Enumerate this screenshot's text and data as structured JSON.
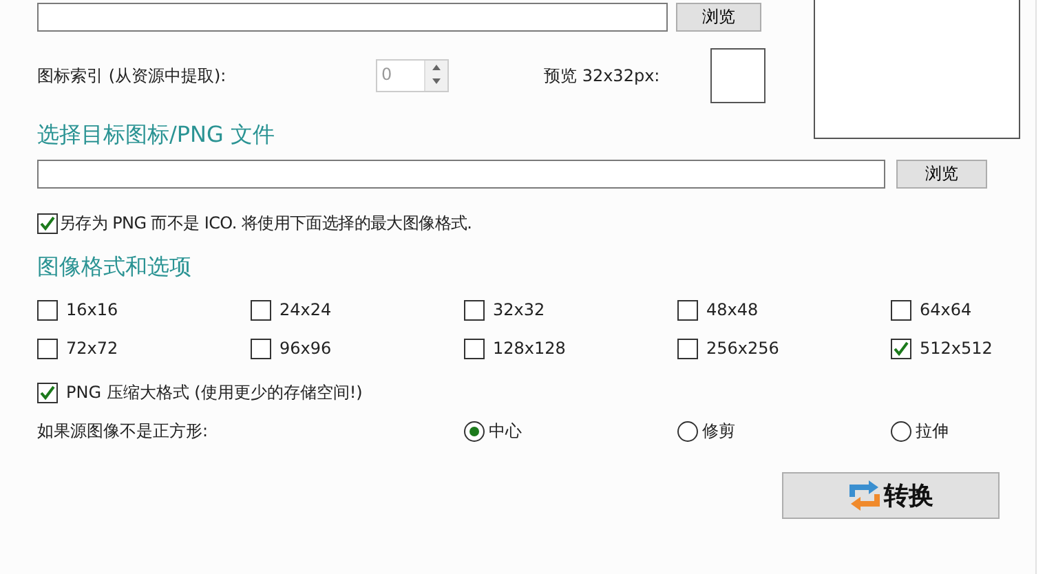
{
  "source": {
    "browse_button": "浏览",
    "icon_index_label": "图标索引 (从资源中提取):",
    "icon_index_value": "0",
    "preview_label": "预览 32x32px:"
  },
  "target": {
    "heading": "选择目标图标/PNG 文件",
    "browse_button": "浏览"
  },
  "save_as_png": {
    "label": "另存为 PNG 而不是 ICO. 将使用下面选择的最大图像格式.",
    "checked": true
  },
  "formats": {
    "heading": "图像格式和选项",
    "sizes": [
      {
        "label": "16x16",
        "checked": false
      },
      {
        "label": "24x24",
        "checked": false
      },
      {
        "label": "32x32",
        "checked": false
      },
      {
        "label": "48x48",
        "checked": false
      },
      {
        "label": "64x64",
        "checked": false
      },
      {
        "label": "72x72",
        "checked": false
      },
      {
        "label": "96x96",
        "checked": false
      },
      {
        "label": "128x128",
        "checked": false
      },
      {
        "label": "256x256",
        "checked": false
      },
      {
        "label": "512x512",
        "checked": true
      }
    ]
  },
  "png_compress": {
    "label": "PNG 压缩大格式 (使用更少的存储空间!)",
    "checked": true
  },
  "non_square": {
    "label": "如果源图像不是正方形:",
    "options": [
      {
        "label": "中心",
        "selected": true
      },
      {
        "label": "修剪",
        "selected": false
      },
      {
        "label": "拉伸",
        "selected": false
      }
    ]
  },
  "convert_button": "转换"
}
